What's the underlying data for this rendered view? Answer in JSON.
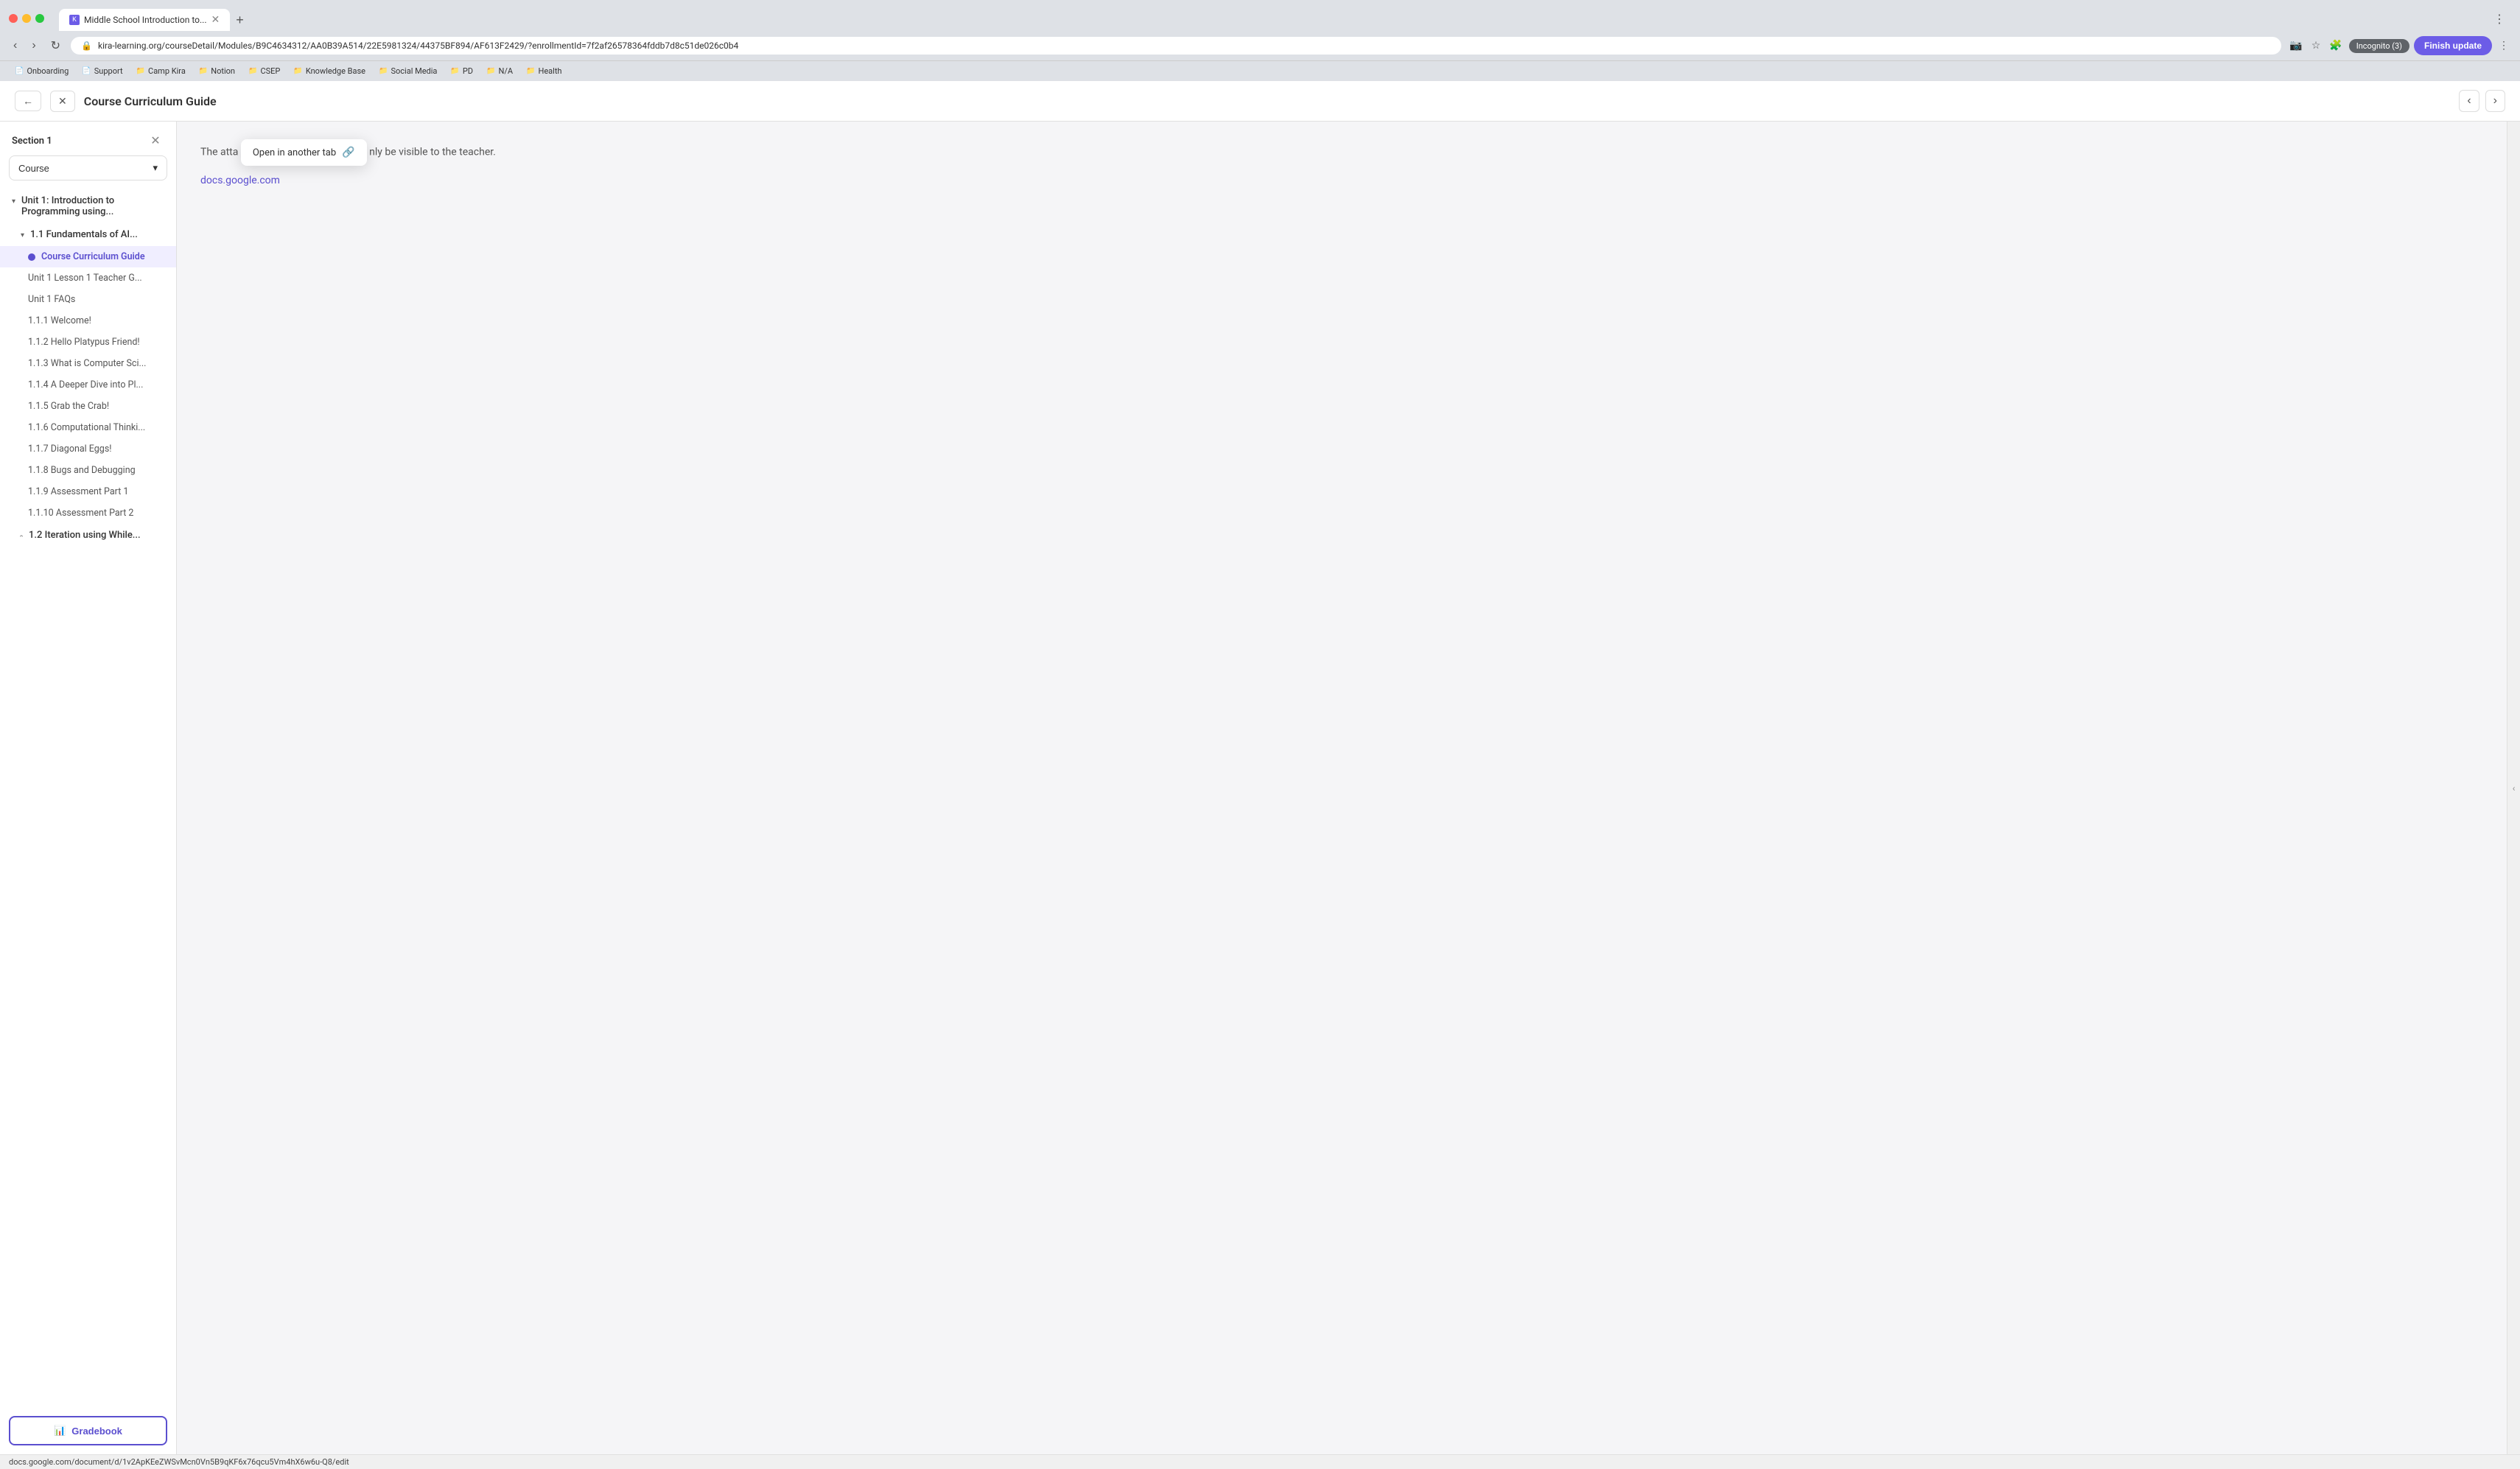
{
  "browser": {
    "tab_title": "Middle School Introduction to...",
    "tab_favicon_text": "K",
    "url": "kira-learning.org/courseDetail/Modules/B9C4634312/AA0B39A514/22E5981324/44375BF894/AF613F2429/?enrollmentId=7f2af26578364fddb7d8c51de026c0b4",
    "new_tab_label": "+",
    "nav_back": "‹",
    "nav_forward": "›",
    "nav_refresh": "↻",
    "incognito_label": "Incognito (3)",
    "finish_update_label": "Finish update",
    "bookmarks": [
      {
        "id": "onboarding",
        "label": "Onboarding",
        "icon": "📄"
      },
      {
        "id": "support",
        "label": "Support",
        "icon": "📄"
      },
      {
        "id": "camp-kira",
        "label": "Camp Kira",
        "icon": "📁"
      },
      {
        "id": "notion",
        "label": "Notion",
        "icon": "📁"
      },
      {
        "id": "csep",
        "label": "CSEP",
        "icon": "📁"
      },
      {
        "id": "knowledge-base",
        "label": "Knowledge Base",
        "icon": "📁"
      },
      {
        "id": "social-media",
        "label": "Social Media",
        "icon": "📁"
      },
      {
        "id": "pd",
        "label": "PD",
        "icon": "📁"
      },
      {
        "id": "na",
        "label": "N/A",
        "icon": "📁"
      },
      {
        "id": "health",
        "label": "Health",
        "icon": "📁"
      }
    ]
  },
  "panel": {
    "back_btn": "←",
    "close_btn": "✕",
    "title": "Course Curriculum Guide",
    "prev_btn": "‹",
    "next_btn": "›"
  },
  "sidebar": {
    "section_label": "Section 1",
    "dropdown_value": "Course",
    "dropdown_chevron": "▾",
    "units": [
      {
        "id": "unit1",
        "label": "Unit 1: Introduction to Programming using...",
        "expanded": true,
        "lessons": [
          {
            "id": "lesson-fundamentals",
            "label": "1.1 Fundamentals of AI...",
            "expanded": true,
            "items": [
              {
                "id": "course-curriculum",
                "label": "Course Curriculum Guide",
                "active": true
              },
              {
                "id": "unit1-teacher",
                "label": "Unit 1 Lesson 1 Teacher G..."
              },
              {
                "id": "unit1-faqs",
                "label": "Unit 1 FAQs"
              },
              {
                "id": "lesson-1-1-1",
                "label": "1.1.1 Welcome!"
              },
              {
                "id": "lesson-1-1-2",
                "label": "1.1.2 Hello Platypus Friend!"
              },
              {
                "id": "lesson-1-1-3",
                "label": "1.1.3 What is Computer Sci..."
              },
              {
                "id": "lesson-1-1-4",
                "label": "1.1.4 A Deeper Dive into Pl..."
              },
              {
                "id": "lesson-1-1-5",
                "label": "1.1.5 Grab the Crab!"
              },
              {
                "id": "lesson-1-1-6",
                "label": "1.1.6 Computational Thinki..."
              },
              {
                "id": "lesson-1-1-7",
                "label": "1.1.7 Diagonal Eggs!"
              },
              {
                "id": "lesson-1-1-8",
                "label": "1.1.8 Bugs and Debugging"
              },
              {
                "id": "lesson-1-1-9",
                "label": "1.1.9 Assessment Part 1"
              },
              {
                "id": "lesson-1-1-10",
                "label": "1.1.10 Assessment Part 2"
              }
            ]
          },
          {
            "id": "lesson-iteration",
            "label": "1.2 Iteration using While...",
            "expanded": false,
            "items": []
          }
        ]
      }
    ],
    "gradebook_btn": "Gradebook",
    "gradebook_icon": "📊"
  },
  "content": {
    "partial_text_before": "The atta",
    "partial_text_after": "nly be visible to the teacher.",
    "popup_label": "Open in another tab",
    "popup_link_icon": "🔗",
    "link_text": "docs.google.com"
  },
  "status_bar": {
    "url": "docs.google.com/document/d/1v2ApKEeZWSvMcn0Vn5B9qKF6x76qcu5Vm4hX6w6u-Q8/edit"
  }
}
